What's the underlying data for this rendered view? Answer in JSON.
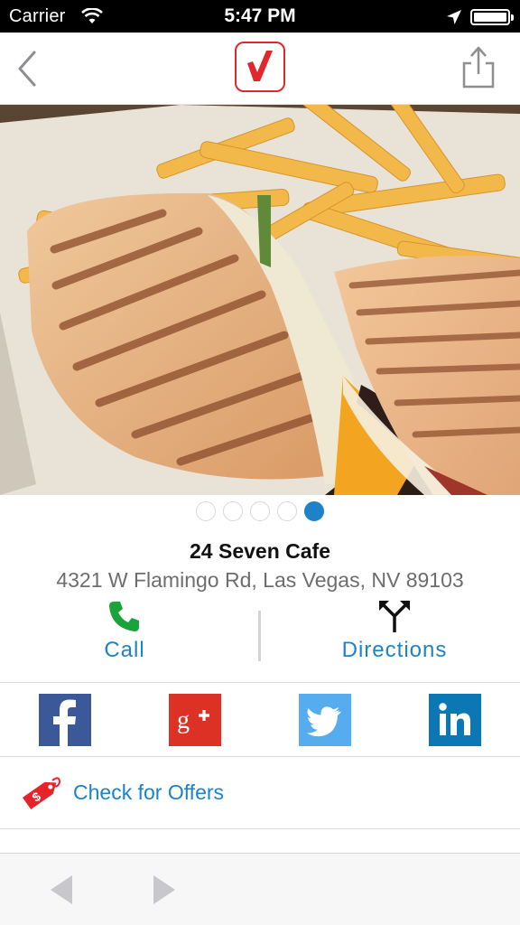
{
  "status_bar": {
    "carrier": "Carrier",
    "time": "5:47 PM",
    "icons": [
      "wifi-icon",
      "location-arrow-icon",
      "battery-icon"
    ]
  },
  "nav": {
    "back_icon": "chevron-left-icon",
    "logo_icon": "checkmark-logo-icon",
    "share_icon": "share-icon",
    "accent_color": "#e3262c"
  },
  "gallery": {
    "image_description_icon": "food-photo",
    "page_count": 5,
    "active_page": 5,
    "active_color": "#1e82c8"
  },
  "business": {
    "name": "24 Seven Cafe",
    "address": "4321 W Flamingo Rd, Las Vegas, NV 89103"
  },
  "actions": {
    "call_label": "Call",
    "directions_label": "Directions",
    "link_color": "#1e82c8"
  },
  "social": [
    {
      "icon": "facebook-icon",
      "color": "#3b5998"
    },
    {
      "icon": "google-plus-icon",
      "color": "#dd3125"
    },
    {
      "icon": "twitter-icon",
      "color": "#55acee"
    },
    {
      "icon": "linkedin-icon",
      "color": "#0b77b5"
    }
  ],
  "offers": {
    "label": "Check for Offers",
    "icon": "price-tag-icon"
  },
  "toolbar": {
    "back_icon": "triangle-left-icon",
    "forward_icon": "triangle-right-icon"
  }
}
